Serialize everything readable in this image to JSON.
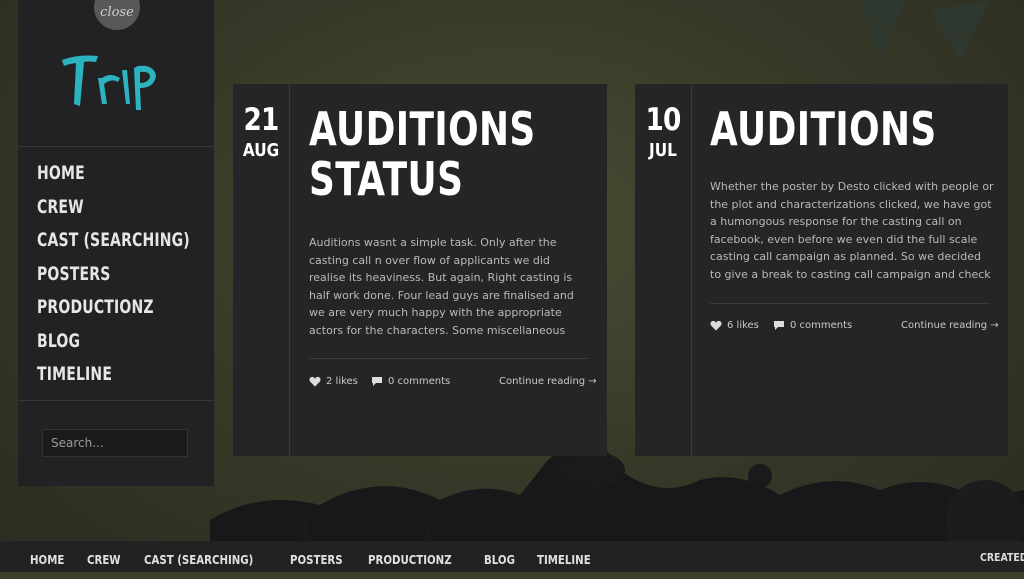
{
  "close_label": "close",
  "logo_text": "TRIP",
  "accent_color": "#2bb3c0",
  "sidebar": {
    "menu": [
      "HOME",
      "CREW",
      "CAST (SEARCHING)",
      "POSTERS",
      "PRODUCTIONZ",
      "BLOG",
      "TIMELINE"
    ],
    "search_placeholder": "Search..."
  },
  "posts": [
    {
      "day": "21",
      "month": "AUG",
      "title_line1": "AUDITIONS",
      "title_line2": "STATUS",
      "excerpt": "Auditions wasnt a simple task. Only after the casting call n over flow of applicants we did realise its heaviness. But again, Right casting is half work done. Four lead guys are finalised and we are very much happy with the appropriate actors for the characters. Some miscellaneous cast is yet to be finalised. Now",
      "likes": "2 likes",
      "comments": "0 comments",
      "continue": "Continue reading →"
    },
    {
      "day": "10",
      "month": "JUL",
      "title_line1": "AUDITIONS",
      "title_line2": "",
      "excerpt": "Whether the poster by Desto clicked with people or the plot and characterizations clicked, we have got a humongous response for the casting call on facebook, even before we even did the full scale casting call campaign as planned. So we decided to give a break to casting call campaign and check out the applicants.",
      "likes": "6 likes",
      "comments": "0 comments",
      "continue": "Continue reading →"
    }
  ],
  "footer": {
    "nav": [
      "HOME",
      "CREW",
      "CAST (SEARCHING)",
      "POSTERS",
      "PRODUCTIONZ",
      "BLOG",
      "TIMELINE"
    ],
    "credit": "CREATED B"
  }
}
